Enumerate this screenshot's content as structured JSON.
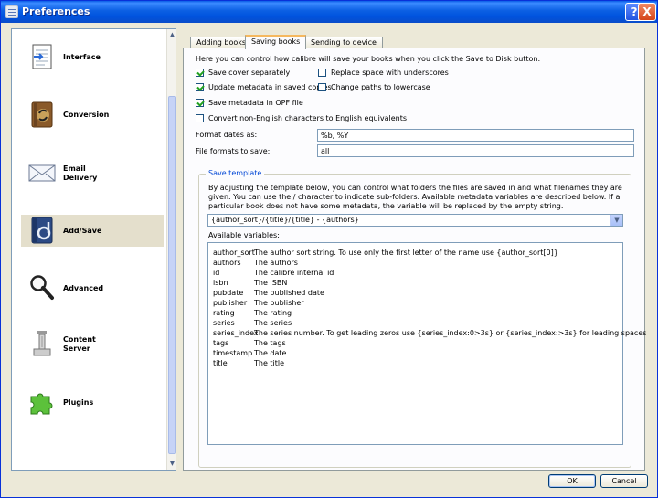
{
  "window": {
    "title": "Preferences",
    "help_label": "?",
    "close_label": "X"
  },
  "sidebar": {
    "items": [
      {
        "label": "Interface",
        "icon": "interface-icon"
      },
      {
        "label": "Conversion",
        "icon": "conversion-icon"
      },
      {
        "label": "Email\nDelivery",
        "icon": "email-icon"
      },
      {
        "label": "Add/Save",
        "icon": "add-save-icon",
        "selected": true
      },
      {
        "label": "Advanced",
        "icon": "magnifier-icon"
      },
      {
        "label": "Content\nServer",
        "icon": "server-icon"
      },
      {
        "label": "Plugins",
        "icon": "puzzle-icon"
      }
    ]
  },
  "tabs": [
    "Adding books",
    "Saving books",
    "Sending to device"
  ],
  "active_tab": "Saving books",
  "panel": {
    "intro": "Here you can control how calibre will save your books when you click the Save to Disk button:",
    "options": {
      "save_cover": {
        "label": "Save cover separately",
        "checked": true
      },
      "replace_space": {
        "label": "Replace space with underscores",
        "checked": false
      },
      "update_metadata": {
        "label": "Update metadata in saved copies",
        "checked": true
      },
      "lowercase_paths": {
        "label": "Change paths to lowercase",
        "checked": false
      },
      "save_opf": {
        "label": "Save metadata in OPF file",
        "checked": true
      },
      "convert_english": {
        "label": "Convert non-English characters to English equivalents",
        "checked": false
      }
    },
    "format_dates_label": "Format dates as:",
    "format_dates_value": "%b, %Y",
    "file_formats_label": "File formats to save:",
    "file_formats_value": "all",
    "template_group_title": "Save template",
    "template_description": "By adjusting the template below, you can control what folders the files are saved in and what filenames they are given. You can use the / character to indicate sub-folders. Available metadata variables are described below. If a particular book does not have some metadata, the variable will be replaced by the empty string.",
    "template_value": "{author_sort}/{title}/{title} - {authors}",
    "available_variables_label": "Available variables:",
    "variables": [
      {
        "name": "author_sort",
        "desc": "The author sort string. To use only the first letter of the name use {author_sort[0]}"
      },
      {
        "name": "authors",
        "desc": "The authors"
      },
      {
        "name": "id",
        "desc": "The calibre internal id"
      },
      {
        "name": "isbn",
        "desc": "The ISBN"
      },
      {
        "name": "pubdate",
        "desc": "The published date"
      },
      {
        "name": "publisher",
        "desc": "The publisher"
      },
      {
        "name": "rating",
        "desc": "The rating"
      },
      {
        "name": "series",
        "desc": "The series"
      },
      {
        "name": "series_index",
        "desc": "The series number. To get leading zeros use {series_index:0>3s} or {series_index:>3s} for leading spaces"
      },
      {
        "name": "tags",
        "desc": "The tags"
      },
      {
        "name": "timestamp",
        "desc": "The date"
      },
      {
        "name": "title",
        "desc": "The title"
      }
    ]
  },
  "buttons": {
    "ok": "OK",
    "cancel": "Cancel"
  },
  "colors": {
    "titlebar": "#0053df",
    "selection": "#e4dfcc",
    "group_title": "#0046d5"
  }
}
